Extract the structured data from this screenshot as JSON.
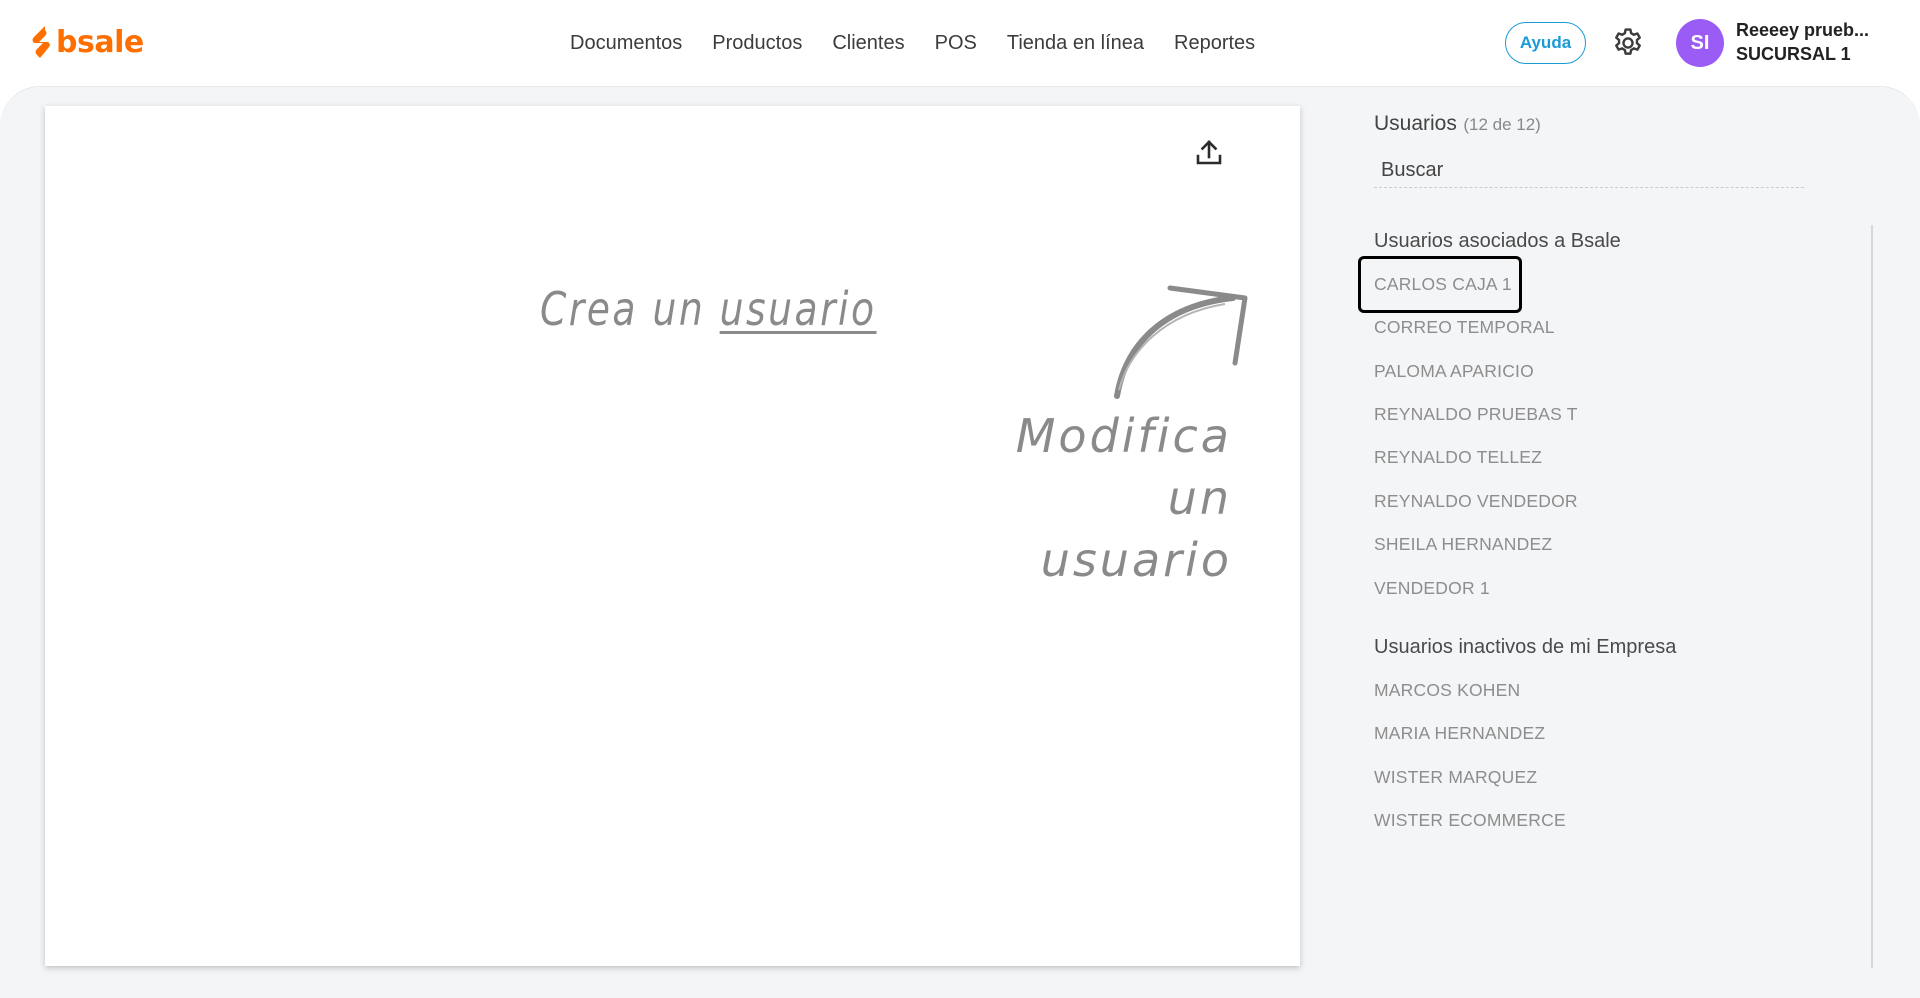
{
  "brand": {
    "logo_text": "bsale",
    "accent_color": "#ff6f00"
  },
  "nav": {
    "items": [
      "Documentos",
      "Productos",
      "Clientes",
      "POS",
      "Tienda en línea",
      "Reportes"
    ]
  },
  "header": {
    "help_label": "Ayuda",
    "settings_icon": "gear-icon",
    "avatar_initials": "SI",
    "avatar_color": "#9b5cf6",
    "user_name": "Reeeey prueb...",
    "branch": "SUCURSAL 1"
  },
  "canvas": {
    "upload_icon": "upload-icon",
    "hint_create_prefix": "Crea un",
    "hint_create_link": "usuario",
    "hint_modify_line1": "Modifica un",
    "hint_modify_line2": "usuario"
  },
  "panel": {
    "title": "Usuarios",
    "count": "(12 de 12)",
    "search_placeholder": "Buscar",
    "associated_title": "Usuarios asociados a Bsale",
    "associated_users": [
      "CARLOS CAJA 1",
      "CORREO TEMPORAL",
      "PALOMA APARICIO",
      "REYNALDO PRUEBAS T",
      "REYNALDO TELLEZ",
      "REYNALDO VENDEDOR",
      "SHEILA HERNANDEZ",
      "VENDEDOR 1"
    ],
    "selected_user": "CARLOS CAJA 1",
    "inactive_title": "Usuarios inactivos de mi Empresa",
    "inactive_users": [
      "MARCOS KOHEN",
      "MARIA HERNANDEZ",
      "WISTER MARQUEZ",
      "WISTER ECOMMERCE"
    ]
  }
}
